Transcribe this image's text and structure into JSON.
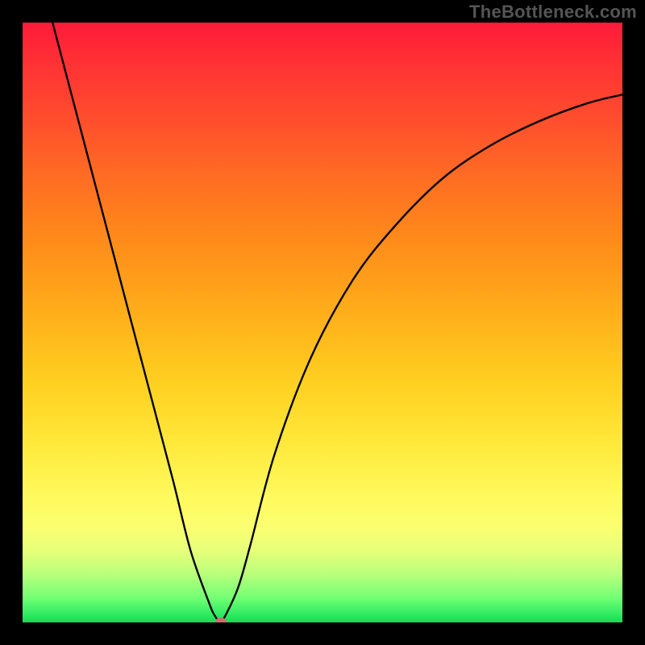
{
  "watermark": "TheBottleneck.com",
  "colors": {
    "frame_bg": "#000000",
    "curve_stroke": "#000000",
    "marker_fill": "#cf6e6e",
    "gradient_stops": [
      "#ff1a3a",
      "#ff2f35",
      "#ff4a2e",
      "#ff6a24",
      "#ff8a1a",
      "#ffad1a",
      "#ffd020",
      "#ffe83a",
      "#fff85a",
      "#fbff70",
      "#e8ff7a",
      "#b8ff7c",
      "#70ff74",
      "#27e85e",
      "#1dd657"
    ]
  },
  "chart_data": {
    "type": "line",
    "title": "",
    "xlabel": "",
    "ylabel": "",
    "xlim": [
      0,
      100
    ],
    "ylim": [
      0,
      100
    ],
    "grid": false,
    "x": [
      5,
      10,
      15,
      20,
      25,
      28,
      31,
      32,
      33,
      34,
      36,
      38,
      42,
      48,
      55,
      62,
      70,
      78,
      86,
      94,
      100
    ],
    "values": [
      100,
      81,
      62,
      43,
      24,
      12,
      3.5,
      1.2,
      0.2,
      1.5,
      6,
      13,
      28,
      44,
      57,
      66,
      74,
      79.5,
      83.5,
      86.5,
      88
    ],
    "minimum": {
      "x": 33,
      "y": 0.2
    },
    "note": "V-shaped bottleneck curve. Background gradient encodes severity (red top = high, green bottom = low). Values are read off the image relative to the 0–100 plot box; the original chart carries no visible axes, ticks, or labels."
  }
}
